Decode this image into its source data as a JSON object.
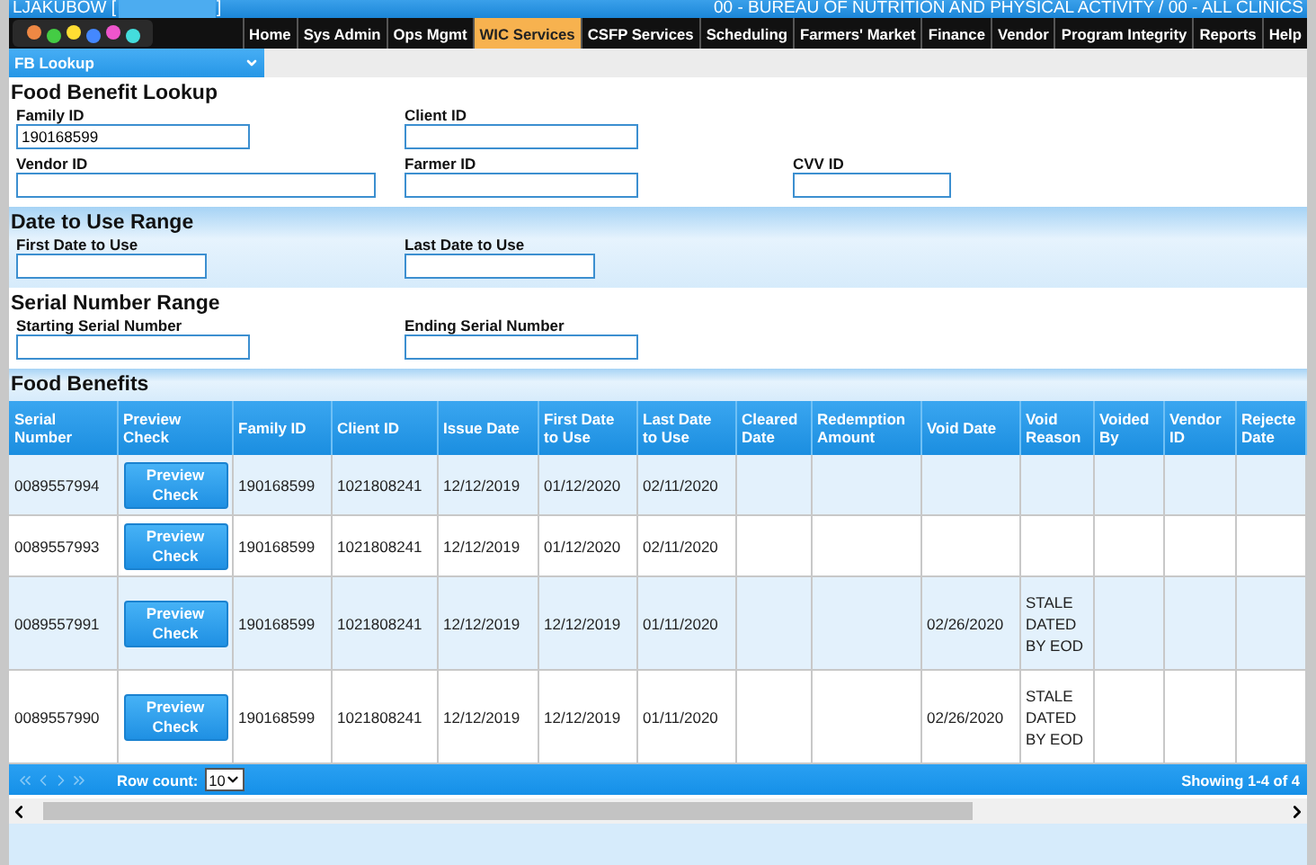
{
  "top_bar": {
    "user": "LJAKUBOW [",
    "user_end": "]",
    "agency": "00 - BUREAU OF NUTRITION AND PHYSICAL ACTIVITY / 00 - ALL CLINICS"
  },
  "menu": [
    {
      "label": "Home",
      "selected": false
    },
    {
      "label": "Sys Admin",
      "selected": false
    },
    {
      "label": "Ops Mgmt",
      "selected": false
    },
    {
      "label": "WIC Services",
      "selected": true
    },
    {
      "label": "CSFP Services",
      "selected": false
    },
    {
      "label": "Scheduling",
      "selected": false
    },
    {
      "label": "Farmers' Market",
      "selected": false
    },
    {
      "label": "Finance",
      "selected": false
    },
    {
      "label": "Vendor",
      "selected": false
    },
    {
      "label": "Program Integrity",
      "selected": false
    },
    {
      "label": "Reports",
      "selected": false
    },
    {
      "label": "Help",
      "selected": false
    }
  ],
  "page_select": {
    "value": "FB Lookup"
  },
  "sections": [
    {
      "title": "Food Benefit Lookup",
      "shaded": false,
      "rows": [
        [
          {
            "label": "Family ID",
            "value": "190168599"
          },
          {
            "label": "Client ID"
          }
        ],
        [
          {
            "label": "Vendor ID"
          },
          {
            "label": "Farmer ID"
          },
          {
            "label": "CVV ID"
          }
        ]
      ]
    },
    {
      "title": "Date to Use Range",
      "shaded": true,
      "rows": [
        [
          {
            "label": "First Date to Use"
          },
          {
            "label": "Last Date to Use"
          }
        ]
      ]
    },
    {
      "title": "Serial Number Range",
      "shaded": false,
      "rows": [
        [
          {
            "label": "Starting Serial Number"
          },
          {
            "label": "Ending Serial Number"
          }
        ]
      ]
    }
  ],
  "table": {
    "title": "Food Benefits",
    "columns": [
      "Serial Number",
      "Preview Check",
      "Family ID",
      "Client ID",
      "Issue Date",
      "First Date to Use",
      "Last Date to Use",
      "Cleared Date",
      "Redemption Amount",
      "Void Date",
      "Void Reason",
      "Voided By",
      "Vendor ID",
      "Rejecte Date"
    ],
    "rows": [
      [
        "0089557994",
        "Preview Check",
        "190168599",
        "1021808241",
        "12/12/2019",
        "01/12/2020",
        "02/11/2020",
        "",
        "",
        "",
        "",
        "",
        "",
        ""
      ],
      [
        "0089557993",
        "Preview Check",
        "190168599",
        "1021808241",
        "12/12/2019",
        "01/12/2020",
        "02/11/2020",
        "",
        "",
        "",
        "",
        "",
        "",
        ""
      ],
      [
        "0089557991",
        "Preview Check",
        "190168599",
        "1021808241",
        "12/12/2019",
        "12/12/2019",
        "01/11/2020",
        "",
        "",
        "02/26/2020",
        "STALE DATED BY EOD",
        "",
        "",
        ""
      ],
      [
        "0089557990",
        "Preview Check",
        "190168599",
        "1021808241",
        "12/12/2019",
        "12/12/2019",
        "01/11/2020",
        "",
        "",
        "02/26/2020",
        "STALE DATED BY EOD",
        "",
        "",
        ""
      ]
    ],
    "row_count_label": "Row count:",
    "row_count": "10",
    "showing": "Showing 1-4 of 4"
  }
}
